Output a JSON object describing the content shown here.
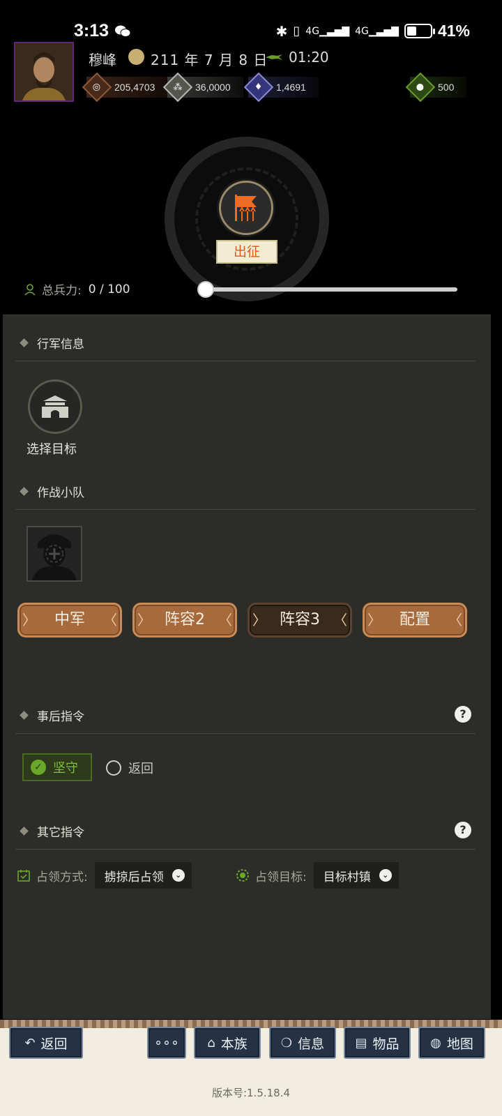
{
  "status_bar": {
    "time": "3:13",
    "battery_level": 0.41,
    "battery_text": "41%"
  },
  "header": {
    "player_name": "穆峰",
    "date": "211 年 7 月 8 日",
    "game_time": "01:20",
    "resources": [
      {
        "icon": "coins-icon",
        "value": "205,4703"
      },
      {
        "icon": "grain-icon",
        "value": "36,0000"
      },
      {
        "icon": "soldier-icon",
        "value": "1,4691"
      },
      {
        "icon": "money-bag-icon",
        "value": "500"
      }
    ]
  },
  "march": {
    "button_label": "出征",
    "troop_label": "总兵力:",
    "troop_value": "0 / 100",
    "troop_fraction": 0.0
  },
  "sections": {
    "march_info": "行军信息",
    "combat_squad": "作战小队",
    "after_orders": "事后指令",
    "other_orders": "其它指令"
  },
  "target": {
    "label": "选择目标"
  },
  "lineup_tabs": [
    {
      "label": "中军",
      "active": false
    },
    {
      "label": "阵容2",
      "active": false
    },
    {
      "label": "阵容3",
      "active": true
    },
    {
      "label": "配置",
      "active": false
    }
  ],
  "after_order_options": {
    "hold": "坚守",
    "return": "返回",
    "selected": "坚守"
  },
  "other_orders": {
    "occupy_mode_label": "占领方式:",
    "occupy_mode_value": "掳掠后占领",
    "occupy_target_label": "占领目标:",
    "occupy_target_value": "目标村镇"
  },
  "help_glyph": "?",
  "bottom_nav": {
    "back": "返回",
    "more": "∘∘∘",
    "clan": "本族",
    "info": "信息",
    "items": "物品",
    "map": "地图"
  },
  "version": "版本号:1.5.18.4",
  "colors": {
    "accent_orange": "#e05a1c",
    "active_green": "#7cc235",
    "tab_brown": "#a76a3c"
  }
}
